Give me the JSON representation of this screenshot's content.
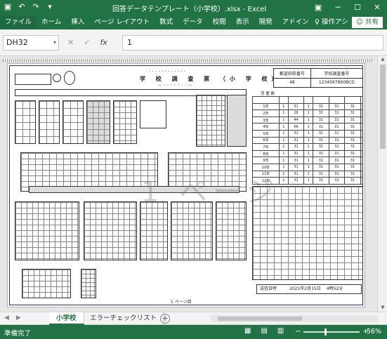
{
  "window": {
    "title": "回答データテンプレート（小学校）.xlsx - Excel",
    "controls": {
      "minimize": "─",
      "restore": "☐",
      "close": "✕",
      "ribbon_options": "▣"
    }
  },
  "ribbon": {
    "tabs": [
      {
        "label": "ファイル"
      },
      {
        "label": "ホーム"
      },
      {
        "label": "挿入"
      },
      {
        "label": "ページ レイアウト"
      },
      {
        "label": "数式"
      },
      {
        "label": "データ"
      },
      {
        "label": "校閲"
      },
      {
        "label": "表示"
      },
      {
        "label": "開発"
      },
      {
        "label": "アドイン"
      }
    ],
    "tell_me": "操作アシ",
    "share": "共有"
  },
  "formula_bar": {
    "name_box": "DH32",
    "formula": "1",
    "cancel_icon": "✕",
    "enter_icon": "✓",
    "fx_label": "fx"
  },
  "sheet": {
    "form_title": "学 校 調 査 票 （小 学 校）",
    "code_header_left": "都道府県番号",
    "code_header_right": "学校調査番号",
    "code_value_left": "48",
    "code_value_right": "1234567890BCD",
    "right_table_title": "児 童 数",
    "grades": [
      "1年",
      "2年",
      "3年",
      "4年",
      "5年",
      "6年",
      "7年",
      "8年",
      "9年",
      "10年",
      "11年",
      "12年"
    ],
    "rows": [
      [
        "1",
        "31",
        "1",
        "31",
        "31",
        "31"
      ],
      [
        "1",
        "26",
        "1",
        "31",
        "31",
        "31"
      ],
      [
        "1",
        "44",
        "1",
        "31",
        "31",
        "31"
      ],
      [
        "1",
        "66",
        "1",
        "31",
        "31",
        "31"
      ],
      [
        "1",
        "31",
        "1",
        "31",
        "31",
        "31"
      ],
      [
        "1",
        "31",
        "1",
        "31",
        "31",
        "31"
      ],
      [
        "1",
        "31",
        "1",
        "31",
        "31",
        "31"
      ],
      [
        "1",
        "31",
        "1",
        "31",
        "31",
        "31"
      ],
      [
        "1",
        "31",
        "1",
        "31",
        "31",
        "31"
      ],
      [
        "1",
        "31",
        "1",
        "31",
        "31",
        "31"
      ],
      [
        "1",
        "31",
        "1",
        "31",
        "31",
        "31"
      ],
      [
        "1",
        "31",
        "1",
        "31",
        "31",
        "31"
      ]
    ],
    "sent_label": "送信日時",
    "sent_date": "2021年2月15日",
    "sent_time": "4時52分",
    "page_label": "1 ページ目",
    "watermark": "1 ページ"
  },
  "sheet_tabs": {
    "active": "小学校",
    "other": "エラーチェックリスト",
    "add": "+"
  },
  "status_bar": {
    "ready": "準備完了",
    "zoom_value": "56%",
    "zoom_minus": "−",
    "zoom_plus": "+"
  }
}
